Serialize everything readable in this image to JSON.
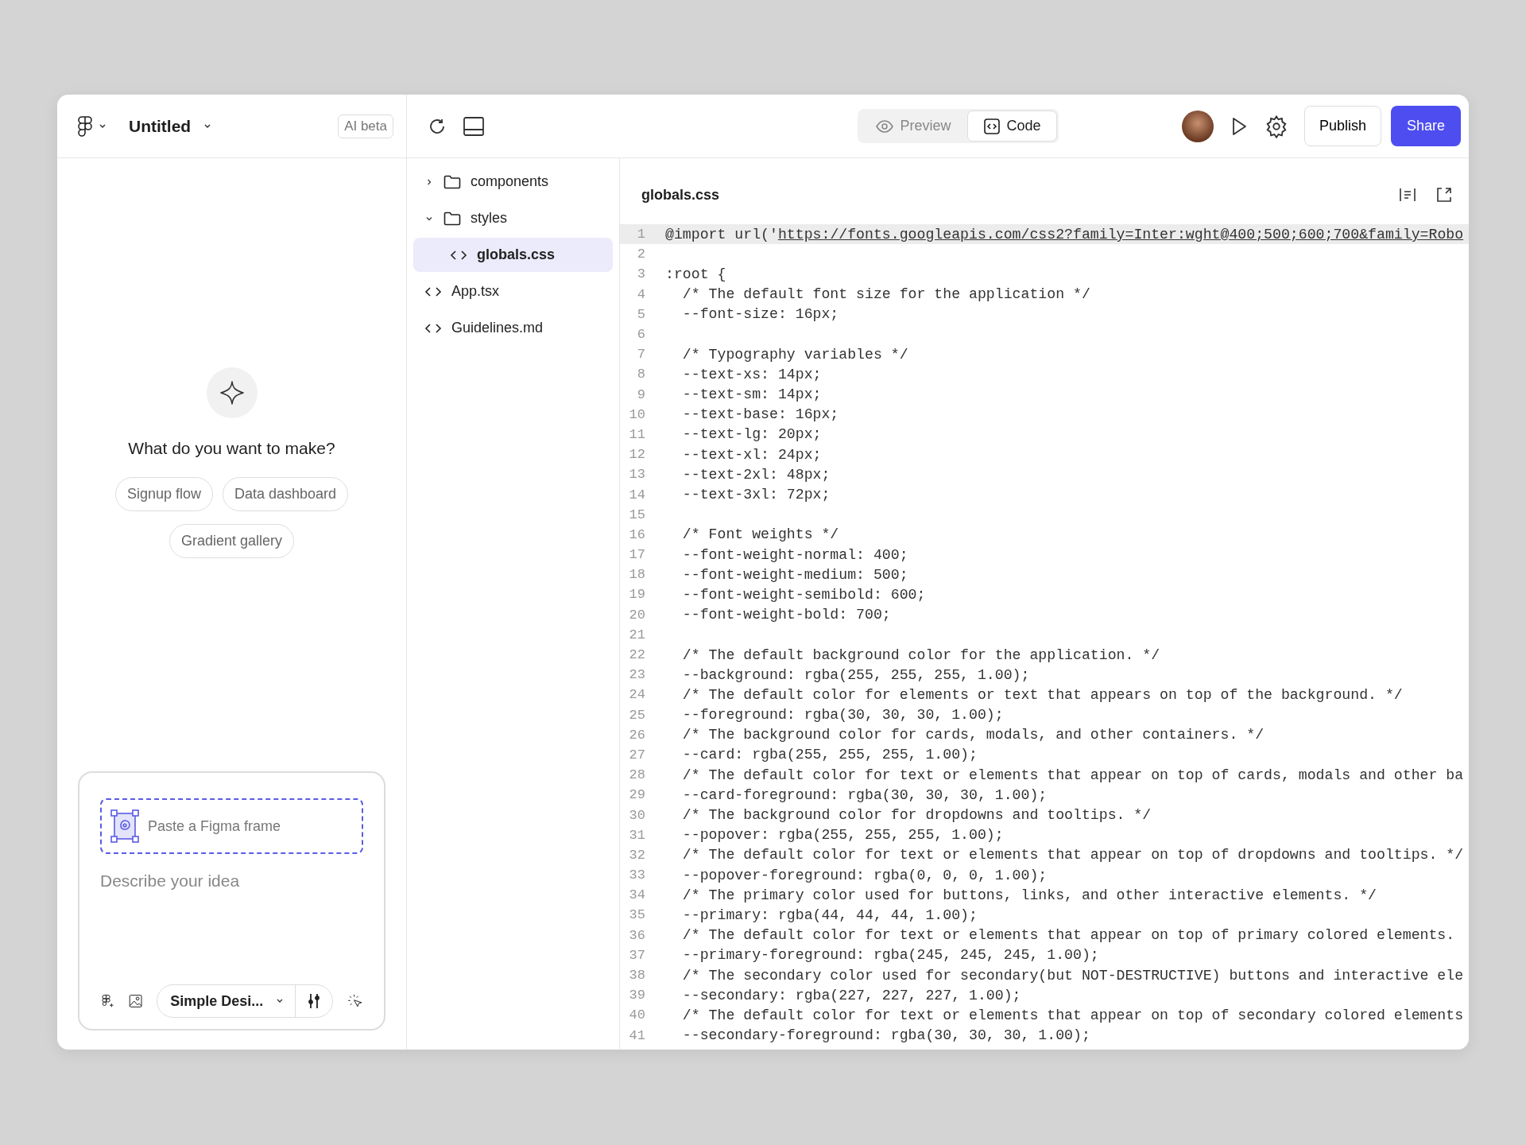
{
  "header": {
    "project_title": "Untitled",
    "ai_badge": "AI beta",
    "view_toggle": [
      {
        "label": "Preview",
        "selected": false,
        "kind": "preview"
      },
      {
        "label": "Code",
        "selected": true,
        "kind": "code"
      }
    ],
    "publish": "Publish",
    "share": "Share"
  },
  "prompt_panel": {
    "question": "What do you want to make?",
    "suggestions": [
      "Signup flow",
      "Data dashboard",
      "Gradient gallery"
    ],
    "paste_frame": "Paste a Figma frame",
    "idea_placeholder": "Describe your idea",
    "style_select": "Simple Desi..."
  },
  "file_tree": [
    {
      "kind": "folder",
      "name": "components",
      "expanded": false,
      "selected": false
    },
    {
      "kind": "folder",
      "name": "styles",
      "expanded": true,
      "selected": false,
      "children": [
        {
          "kind": "file",
          "name": "globals.css",
          "selected": true
        }
      ]
    },
    {
      "kind": "file",
      "name": "App.tsx",
      "selected": false
    },
    {
      "kind": "file",
      "name": "Guidelines.md",
      "selected": false
    }
  ],
  "editor": {
    "filename": "globals.css",
    "lines": [
      {
        "n": "1",
        "text": "@import url('",
        "link": "https://fonts.googleapis.com/css2?family=Inter:wght@400;500;600;700&family=Robo"
      },
      {
        "n": "2"
      },
      {
        "n": "3",
        "text": ":root {"
      },
      {
        "n": "4",
        "text": "  /* The default font size for the application */"
      },
      {
        "n": "5",
        "text": "  --font-size: 16px;"
      },
      {
        "n": "6"
      },
      {
        "n": "7",
        "text": "  /* Typography variables */"
      },
      {
        "n": "8",
        "text": "  --text-xs: 14px;"
      },
      {
        "n": "9",
        "text": "  --text-sm: 14px;"
      },
      {
        "n": "10",
        "text": "  --text-base: 16px;"
      },
      {
        "n": "11",
        "text": "  --text-lg: 20px;"
      },
      {
        "n": "12",
        "text": "  --text-xl: 24px;"
      },
      {
        "n": "13",
        "text": "  --text-2xl: 48px;"
      },
      {
        "n": "14",
        "text": "  --text-3xl: 72px;"
      },
      {
        "n": "15"
      },
      {
        "n": "16",
        "text": "  /* Font weights */"
      },
      {
        "n": "17",
        "text": "  --font-weight-normal: 400;"
      },
      {
        "n": "18",
        "text": "  --font-weight-medium: 500;"
      },
      {
        "n": "19",
        "text": "  --font-weight-semibold: 600;"
      },
      {
        "n": "20",
        "text": "  --font-weight-bold: 700;"
      },
      {
        "n": "21"
      },
      {
        "n": "22",
        "text": "  /* The default background color for the application. */"
      },
      {
        "n": "23",
        "text": "  --background: rgba(255, 255, 255, 1.00);"
      },
      {
        "n": "24",
        "text": "  /* The default color for elements or text that appears on top of the background. */"
      },
      {
        "n": "25",
        "text": "  --foreground: rgba(30, 30, 30, 1.00);"
      },
      {
        "n": "26",
        "text": "  /* The background color for cards, modals, and other containers. */"
      },
      {
        "n": "27",
        "text": "  --card: rgba(255, 255, 255, 1.00);"
      },
      {
        "n": "28",
        "text": "  /* The default color for text or elements that appear on top of cards, modals and other ba"
      },
      {
        "n": "29",
        "text": "  --card-foreground: rgba(30, 30, 30, 1.00);"
      },
      {
        "n": "30",
        "text": "  /* The background color for dropdowns and tooltips. */"
      },
      {
        "n": "31",
        "text": "  --popover: rgba(255, 255, 255, 1.00);"
      },
      {
        "n": "32",
        "text": "  /* The default color for text or elements that appear on top of dropdowns and tooltips. */"
      },
      {
        "n": "33",
        "text": "  --popover-foreground: rgba(0, 0, 0, 1.00);"
      },
      {
        "n": "34",
        "text": "  /* The primary color used for buttons, links, and other interactive elements. */"
      },
      {
        "n": "35",
        "text": "  --primary: rgba(44, 44, 44, 1.00);"
      },
      {
        "n": "36",
        "text": "  /* The default color for text or elements that appear on top of primary colored elements."
      },
      {
        "n": "37",
        "text": "  --primary-foreground: rgba(245, 245, 245, 1.00);"
      },
      {
        "n": "38",
        "text": "  /* The secondary color used for secondary(but NOT-DESTRUCTIVE) buttons and interactive ele"
      },
      {
        "n": "39",
        "text": "  --secondary: rgba(227, 227, 227, 1.00);"
      },
      {
        "n": "40",
        "text": "  /* The default color for text or elements that appear on top of secondary colored elements"
      },
      {
        "n": "41",
        "text": "  --secondary-foreground: rgba(30, 30, 30, 1.00);"
      }
    ]
  }
}
